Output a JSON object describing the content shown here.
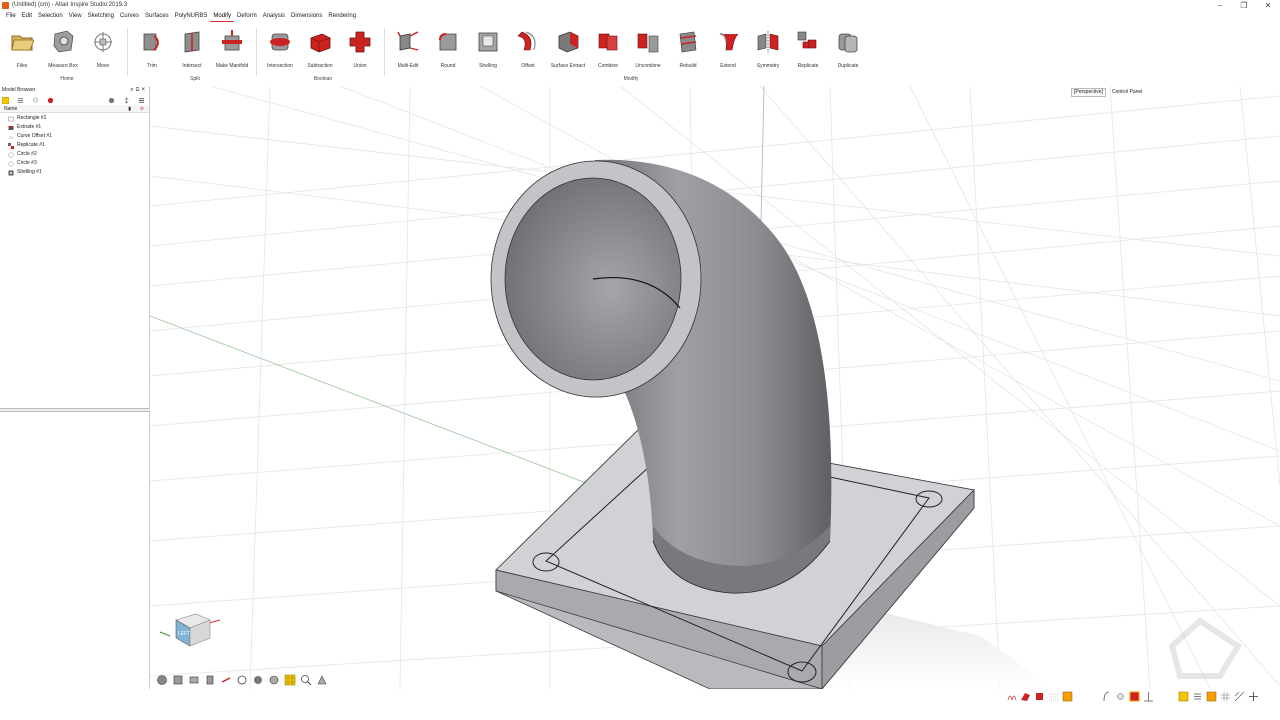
{
  "window": {
    "title": "(Untitled) (cm) - Altair Inspire Studio 2019.3",
    "minimize": "–",
    "restore": "❐",
    "close": "✕"
  },
  "menu": [
    "File",
    "Edit",
    "Selection",
    "View",
    "Sketching",
    "Curves",
    "Surfaces",
    "PolyNURBS",
    "Modify",
    "Deform",
    "Analysis",
    "Dimensions",
    "Rendering"
  ],
  "menu_active": "Modify",
  "ribbon": {
    "tools": [
      {
        "id": "files",
        "label": "Files",
        "icon": "folder-icon"
      },
      {
        "id": "measure-box",
        "label": "Measure Box",
        "icon": "measure-box-icon"
      },
      {
        "id": "move",
        "label": "Move",
        "icon": "move-icon"
      },
      {
        "id": "trim",
        "label": "Trim",
        "icon": "trim-icon"
      },
      {
        "id": "intersect",
        "label": "Intersect",
        "icon": "intersect-icon"
      },
      {
        "id": "make-manifold",
        "label": "Make Manifold",
        "icon": "make-manifold-icon"
      },
      {
        "id": "intersection",
        "label": "Intersection",
        "icon": "intersection-icon"
      },
      {
        "id": "subtraction",
        "label": "Subtraction",
        "icon": "subtraction-icon"
      },
      {
        "id": "union",
        "label": "Union",
        "icon": "union-icon"
      },
      {
        "id": "multi-edit",
        "label": "Multi-Edit",
        "icon": "multi-edit-icon"
      },
      {
        "id": "round",
        "label": "Round",
        "icon": "round-icon"
      },
      {
        "id": "shelling",
        "label": "Shelling",
        "icon": "shelling-icon"
      },
      {
        "id": "offset",
        "label": "Offset",
        "icon": "offset-icon"
      },
      {
        "id": "surface-extract",
        "label": "Surface Extract",
        "icon": "surface-extract-icon"
      },
      {
        "id": "combine",
        "label": "Combine",
        "icon": "combine-icon"
      },
      {
        "id": "uncombine",
        "label": "Uncombine",
        "icon": "uncombine-icon"
      },
      {
        "id": "rebuild",
        "label": "Rebuild",
        "icon": "rebuild-icon"
      },
      {
        "id": "extend",
        "label": "Extend",
        "icon": "extend-icon"
      },
      {
        "id": "symmetry",
        "label": "Symmetry",
        "icon": "symmetry-icon"
      },
      {
        "id": "replicate",
        "label": "Replicate",
        "icon": "replicate-icon"
      },
      {
        "id": "duplicate",
        "label": "Duplicate",
        "icon": "duplicate-icon"
      }
    ],
    "groups": [
      "Home",
      "Split",
      "Boolean",
      "Modify"
    ]
  },
  "browser": {
    "title": "Model Browser",
    "column": "Name",
    "items": [
      {
        "label": "Rectangle #1",
        "icon": "rectangle-sketch-icon"
      },
      {
        "label": "Extrude #1",
        "icon": "extrude-icon"
      },
      {
        "label": "Curve Offset #1",
        "icon": "curve-offset-icon"
      },
      {
        "label": "Replicate #1",
        "icon": "replicate-icon"
      },
      {
        "label": "Circle #2",
        "icon": "circle-sketch-icon"
      },
      {
        "label": "Circle #3",
        "icon": "circle-sketch-icon"
      },
      {
        "label": "Shelling #1",
        "icon": "shelling-icon"
      }
    ]
  },
  "viewport": {
    "projection": "[Perspective]",
    "control_panel": "Control Panel",
    "view_cube_face": "LEFT"
  },
  "colors": {
    "accent": "#cc2222",
    "model_gray": "#9a9ca0",
    "grid": "#e3e6e6"
  }
}
